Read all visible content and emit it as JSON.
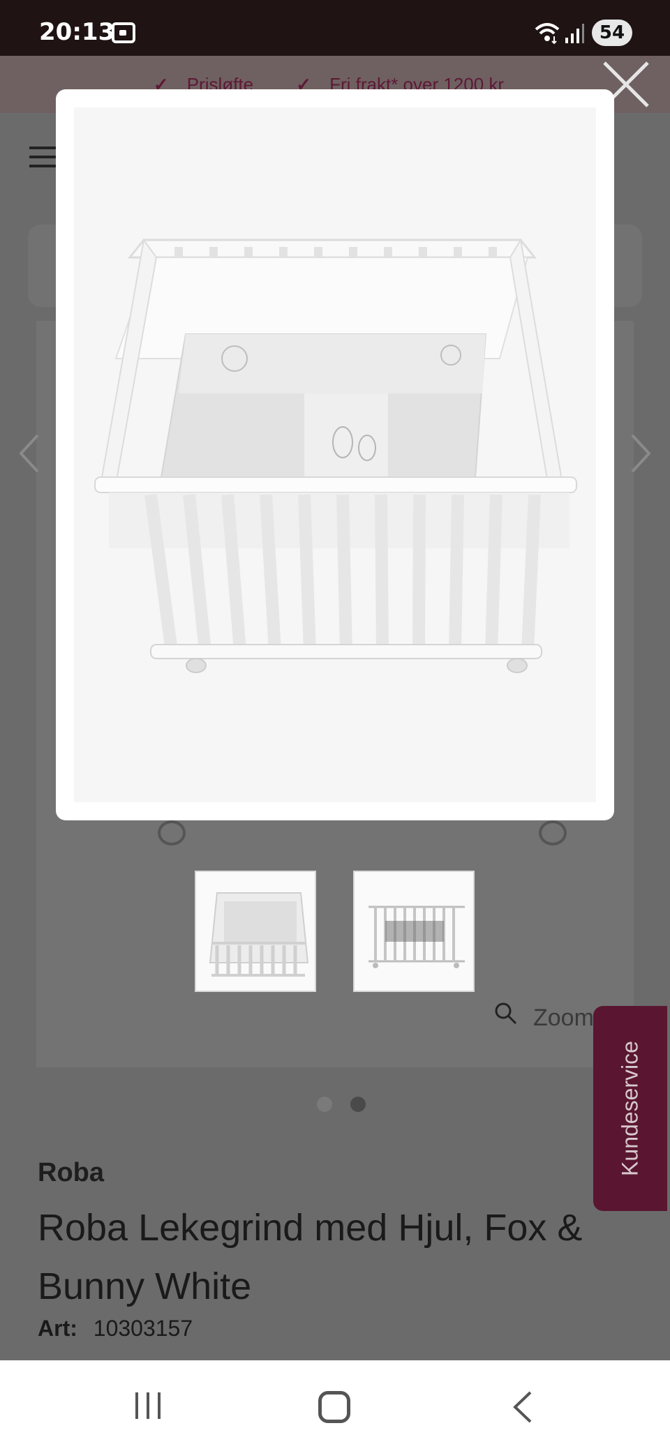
{
  "status_bar": {
    "time": "20:13",
    "battery": "54",
    "icons": [
      "screenshot-icon",
      "wifi-icon",
      "signal-icon"
    ]
  },
  "promo_bar": {
    "items": [
      "Prisløfte",
      "Fri frakt* over 1200 kr"
    ],
    "check_icon": "✓",
    "color": "#5e1836"
  },
  "gallery": {
    "zoom_label": "Zoom",
    "thumbnails": [
      "crib-top-view",
      "crib-side-view"
    ],
    "active_dot": 2,
    "dot_count": 2
  },
  "product": {
    "brand": "Roba",
    "title": "Roba Lekegrind med Hjul, Fox & Bunny White",
    "article_label": "Art:",
    "article_number": "10303157"
  },
  "kundeservice": {
    "label": "Kundeservice",
    "color": "#5a1630"
  },
  "modal": {
    "image_name": "crib-large-image",
    "close_icon": "close-icon"
  },
  "nav": {
    "icons": [
      "recents-icon",
      "home-icon",
      "back-icon"
    ]
  }
}
